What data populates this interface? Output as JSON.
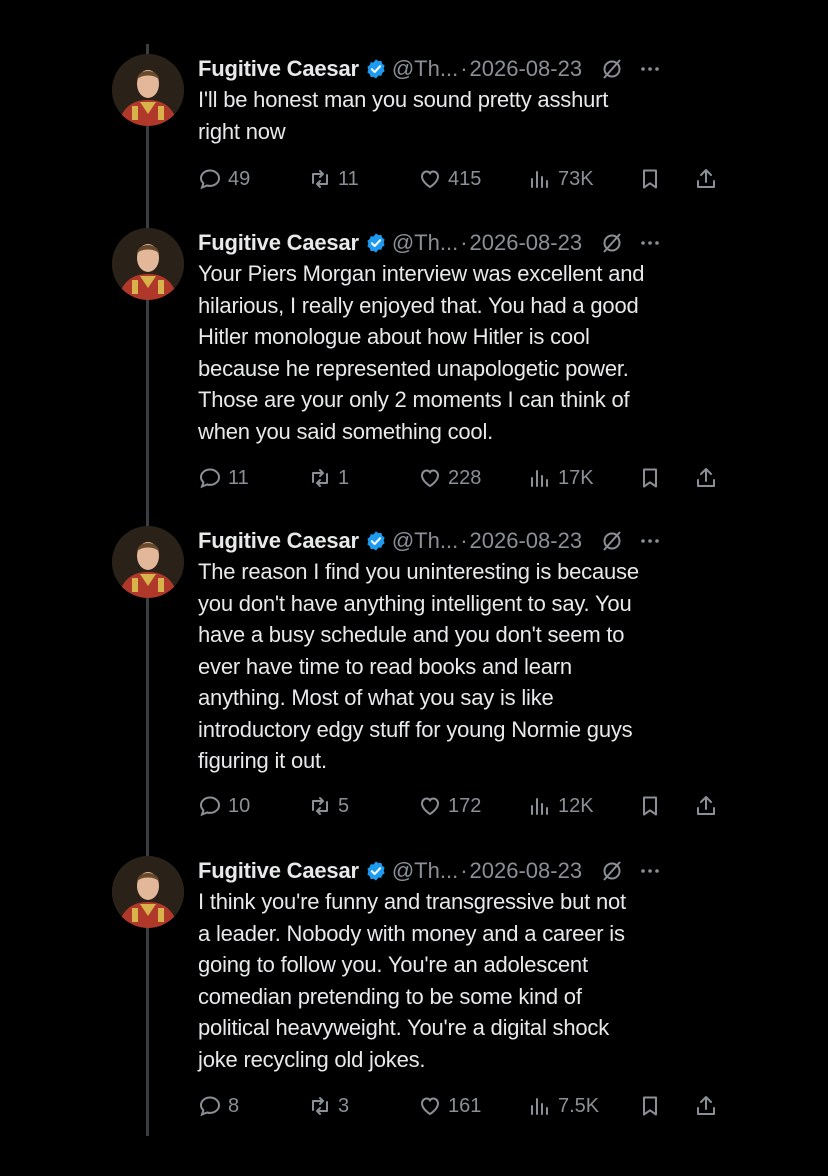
{
  "author": {
    "name": "Fugitive Caesar",
    "handle": "@Th...",
    "verified": true,
    "verified_color": "#1d9bf0"
  },
  "icons": {
    "reply": "reply-icon",
    "repost": "repost-icon",
    "like": "heart-icon",
    "views": "views-icon",
    "bookmark": "bookmark-icon",
    "share": "share-icon",
    "grok": "grok-icon",
    "more": "more-icon"
  },
  "tweets": [
    {
      "separator": "·",
      "date": "2026-08-23",
      "lines": [
        "I'll be honest man you sound pretty asshurt",
        "right now"
      ],
      "replies": "49",
      "reposts": "11",
      "likes": "415",
      "views": "73K"
    },
    {
      "separator": "·",
      "date": "2026-08-23",
      "lines": [
        "Your Piers Morgan interview was excellent and",
        "hilarious, I really enjoyed that. You had a good",
        "Hitler monologue about how Hitler is cool",
        "because he represented unapologetic power.",
        "Those are your only 2 moments I can think of",
        "when you said something cool."
      ],
      "replies": "11",
      "reposts": "1",
      "likes": "228",
      "views": "17K"
    },
    {
      "separator": "·",
      "date": "2026-08-23",
      "lines": [
        "The reason I find you uninteresting is because",
        "you don't have anything intelligent to say. You",
        "have a busy schedule and you don't seem to",
        "ever have time to read books and learn",
        "anything. Most of what you say is like",
        "introductory edgy stuff for young Normie guys",
        "figuring it out."
      ],
      "replies": "10",
      "reposts": "5",
      "likes": "172",
      "views": "12K"
    },
    {
      "separator": "·",
      "date": "2026-08-23",
      "lines": [
        "I think you're funny and transgressive but not",
        "a leader. Nobody with money and a career is",
        "going to follow you. You're an adolescent",
        "comedian pretending to be some kind of",
        "political heavyweight. You're a digital shock",
        "joke recycling old jokes."
      ],
      "replies": "8",
      "reposts": "3",
      "likes": "161",
      "views": "7.5K"
    }
  ]
}
